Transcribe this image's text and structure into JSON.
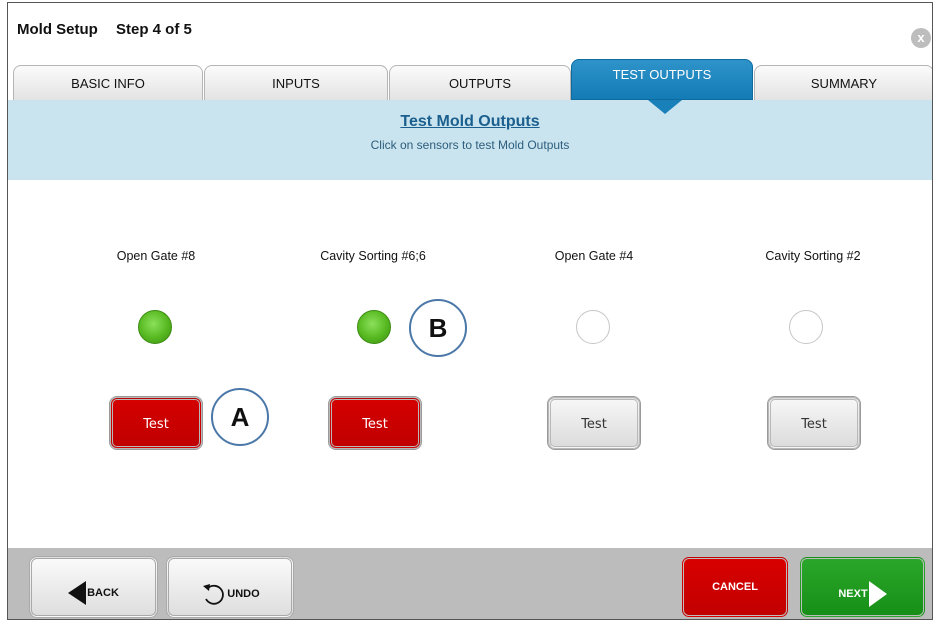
{
  "header": {
    "title": "Mold Setup",
    "step": "Step 4 of 5",
    "close_icon": "close-icon",
    "close_label": "x"
  },
  "tabs": [
    {
      "label": "BASIC INFO",
      "active": false
    },
    {
      "label": "INPUTS",
      "active": false
    },
    {
      "label": "OUTPUTS",
      "active": false
    },
    {
      "label": "TEST OUTPUTS",
      "active": true
    },
    {
      "label": "SUMMARY",
      "active": false
    }
  ],
  "banner": {
    "title": "Test Mold Outputs",
    "subtitle": "Click on sensors to test Mold Outputs"
  },
  "outputs": [
    {
      "label": "Open Gate #8",
      "led": "on",
      "button": "Test",
      "button_state": "active"
    },
    {
      "label": "Cavity Sorting #6;6",
      "led": "on",
      "button": "Test",
      "button_state": "active"
    },
    {
      "label": "Open Gate #4",
      "led": "off",
      "button": "Test",
      "button_state": "inactive"
    },
    {
      "label": "Cavity Sorting #2",
      "led": "off",
      "button": "Test",
      "button_state": "inactive"
    }
  ],
  "callouts": {
    "a": "A",
    "b": "B"
  },
  "footer": {
    "back_label": "BACK",
    "undo_label": "UNDO",
    "cancel_label": "CANCEL",
    "next_label": "NEXT"
  },
  "colors": {
    "accent": "#137bb5",
    "banner": "#c9e4ee",
    "led_on": "#56b820",
    "danger": "#c80000",
    "success": "#178f17"
  }
}
